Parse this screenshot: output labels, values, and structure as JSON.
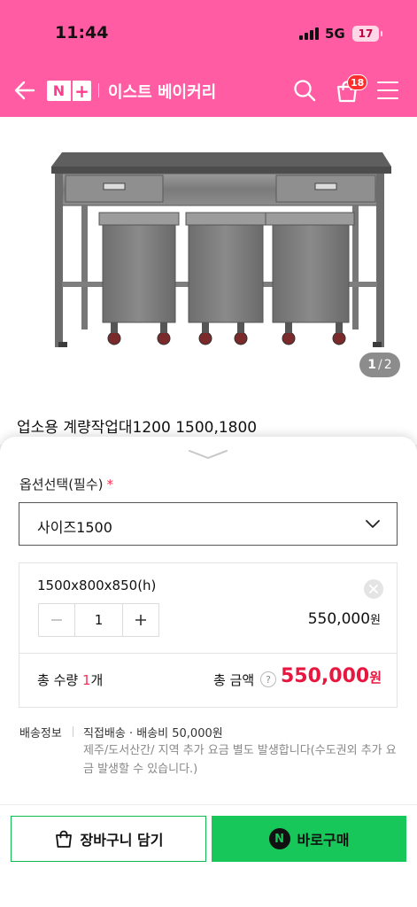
{
  "status_bar": {
    "time": "11:44",
    "network": "5G",
    "battery": "17"
  },
  "nav": {
    "logo_n": "N",
    "logo_plus": "+",
    "store_name": "이스트 베이커리",
    "cart_count": "18",
    "icons": [
      "back-arrow-icon",
      "search-icon",
      "shopping-bag-icon",
      "hamburger-menu-icon"
    ]
  },
  "product": {
    "image_counter": {
      "current": "1",
      "total": "2"
    },
    "title": "업소용 계량작업대1200 1500,1800"
  },
  "options": {
    "label": "옵션선택(필수)",
    "required_mark": "*",
    "selected_value": "사이즈1500"
  },
  "selected_item": {
    "name": "1500x800x850(h)",
    "quantity": "1",
    "price": "550,000",
    "price_unit": "원"
  },
  "totals": {
    "qty_label": "총 수량",
    "qty_value": "1",
    "qty_unit": "개",
    "amount_label": "총 금액",
    "help_mark": "?",
    "amount": "550,000",
    "amount_unit": "원"
  },
  "shipping": {
    "label": "배송정보",
    "main": "직접배송 · 배송비 50,000원",
    "note": "제주/도서산간/ 지역 추가 요금 별도 발생합니다(수도권외 추가 요금 발생할 수 있습니다.)"
  },
  "actions": {
    "cart_label": "장바구니 담기",
    "buy_label": "바로구매",
    "npay_letter": "N"
  },
  "colors": {
    "brand_pink": "#ff5ca3",
    "naver_green": "#17c75a",
    "price_red": "#e8173f"
  }
}
